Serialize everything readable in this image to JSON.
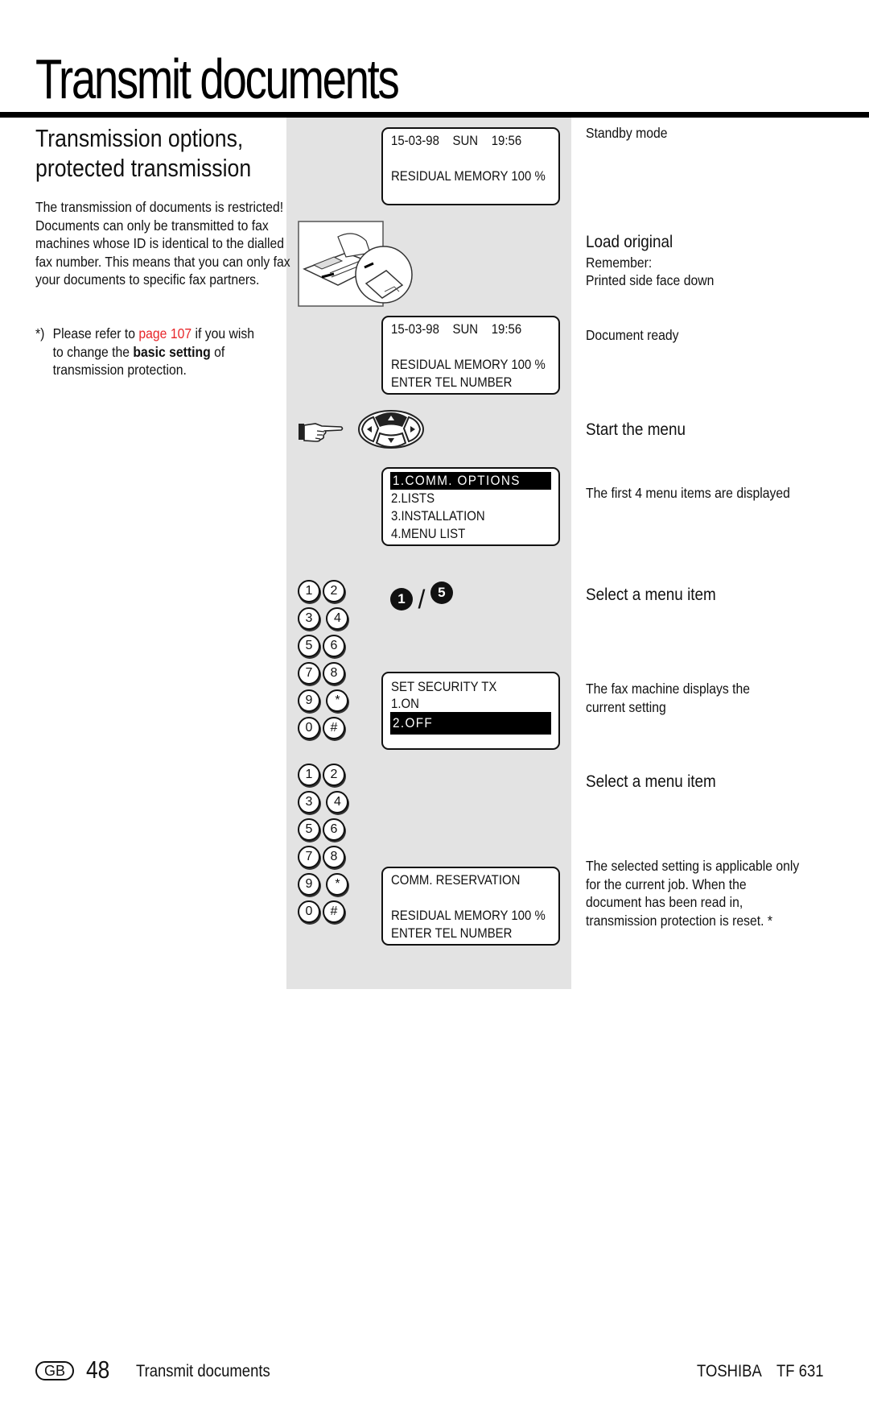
{
  "page": {
    "title": "Transmit documents",
    "section_title_line1": "Transmission options,",
    "section_title_line2": "protected transmission",
    "intro": "The transmission of documents is restricted! Documents can only be transmitted to fax machines whose ID is identical to the dialled fax number. This means that you can only fax your documents to specific fax partners.",
    "note": {
      "mark": "*)",
      "text_before": "Please refer to ",
      "link": "page 107",
      "text_middle": " if you wish to change the ",
      "bold": "basic setting",
      "text_after": " of transmission protection."
    },
    "accent_color": "#e8262a",
    "panel_color": "#e3e3e3"
  },
  "displays": [
    {
      "lines": [
        "15-03-98    SUN    19:56",
        "",
        "RESIDUAL MEMORY 100 %"
      ]
    },
    {
      "lines": [
        "15-03-98    SUN    19:56",
        "",
        "RESIDUAL MEMORY 100 %",
        "ENTER TEL NUMBER"
      ]
    },
    {
      "highlight": "1.COMM. OPTIONS",
      "lines": [
        "2.LISTS",
        "3.INSTALLATION",
        "4.MENU LIST"
      ]
    },
    {
      "lines_top": [
        "SET SECURITY TX",
        "1.ON"
      ],
      "highlight": "2.OFF"
    },
    {
      "lines": [
        "COMM. RESERVATION",
        "",
        "RESIDUAL MEMORY 100 %",
        "ENTER TEL NUMBER"
      ]
    }
  ],
  "keypad": {
    "keys": [
      "1",
      "2",
      "3",
      "4",
      "5",
      "6",
      "7",
      "8",
      "9",
      "*",
      "0",
      "#"
    ]
  },
  "key_sequence": {
    "first": "1",
    "separator": "/",
    "second": "5"
  },
  "steps": {
    "standby": "Standby mode",
    "load_title": "Load original",
    "load_line1": "Remember:",
    "load_line2": "Printed side face down",
    "document_ready": "Document ready",
    "start_menu": "Start the menu",
    "first_items": "The first 4 menu items are displayed",
    "select_item_1": "Select a menu item",
    "current_setting": "The fax machine displays the current setting",
    "select_item_2": "Select a menu item",
    "selected_info": "The selected setting is applicable only for the current job. When the document has been read in, transmission protection is reset. *"
  },
  "footer": {
    "region": "GB",
    "page_number": "48",
    "section": "Transmit documents",
    "brand": "TOSHIBA",
    "model": "TF 631"
  }
}
